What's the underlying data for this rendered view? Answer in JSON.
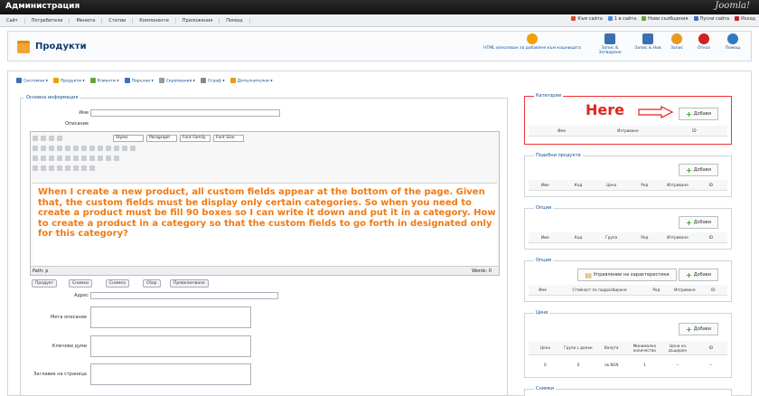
{
  "window": {
    "title": "Администрация",
    "brand": "Joomla!"
  },
  "menu": [
    "Сайт",
    "Потребители",
    "Менюта",
    "Статии",
    "Компоненти",
    "Приложения",
    "Помощ"
  ],
  "menu_right": [
    {
      "label": "Към сайта",
      "color": "#d94a1e"
    },
    {
      "label": "1 в сайта",
      "color": "#4a8bd9"
    },
    {
      "label": "Нови съобщения",
      "color": "#6aa33a"
    },
    {
      "label": "Пусни сайта",
      "color": "#3670c4"
    },
    {
      "label": "Изход",
      "color": "#c42020"
    }
  ],
  "header": {
    "title": "Продукти",
    "hint": "HTML използван за добавяне към кошницата",
    "toolbar": [
      {
        "label": "Запис & Затваряне",
        "color": "#f0a000"
      },
      {
        "label": "Запис & Нов",
        "color": "#3d6fb0"
      },
      {
        "label": "Запис",
        "color": "#2c7ac2"
      },
      {
        "label": "Отказ",
        "color": "#e89a20"
      },
      {
        "label": "Помощ",
        "color": "#d02020"
      }
    ]
  },
  "subtoolbar": [
    "Системни",
    "Продукти",
    "Клиенти",
    "Поръчки",
    "Скрепвания",
    "Сграф",
    "Допълнителни"
  ],
  "left": {
    "legend": "Основна информация",
    "name_label": "Име",
    "desc_label": "Описание",
    "style_opts": [
      "Styles",
      "Paragraph",
      "Font Family",
      "Font Size"
    ],
    "overlay_text": "When I create a new product, all custom fields appear at the bottom of the page. Given that, the custom fields must be display only certain categories. So when you need to create a product must be fill 90 boxes so I can write it down and put it in a category. How to create a product in a category so that the custom fields to go forth in designated only for this category?",
    "path_label": "Path: p",
    "word_count": "Words: 0",
    "buttons": [
      "Продукт",
      "Снимки",
      "Снимка",
      "Сбор",
      "Превключване"
    ],
    "address_label": "Адрес",
    "meta_label": "Мета описание",
    "keywords_label": "Ключови думи",
    "page_title_label": "Заглавие на страница"
  },
  "annotation": {
    "here": "Here"
  },
  "panels": [
    {
      "title": "Категории",
      "add": "Добави",
      "cols": [
        "Име",
        "Изтриване",
        "ID"
      ]
    },
    {
      "title": "Подобни продукти",
      "add": "Добави",
      "cols": [
        "Име",
        "Код",
        "Цена",
        "Ред",
        "Изтриване",
        "ID"
      ]
    },
    {
      "title": "Опции",
      "add": "Добави",
      "cols": [
        "Име",
        "Код",
        "Група",
        "Ред",
        "Изтриване",
        "ID"
      ]
    },
    {
      "title": "Опции",
      "add": "Добави",
      "extra": "Управление на характеристики",
      "cols": [
        "Име",
        "Стойност по подразбиране",
        "Ред",
        "Изтриване",
        "ID"
      ]
    },
    {
      "title": "Цени",
      "add": "Добави",
      "cols": [
        "Цена",
        "Група с данък",
        "Валута",
        "Минимално количество",
        "Цена на дъщерен",
        "ID"
      ],
      "row": {
        "price": "0",
        "group": "0",
        "currency": "лв BGN",
        "qty": "1",
        "c5": "--",
        "c6": "--"
      }
    },
    {
      "title": "Снимки"
    }
  ]
}
